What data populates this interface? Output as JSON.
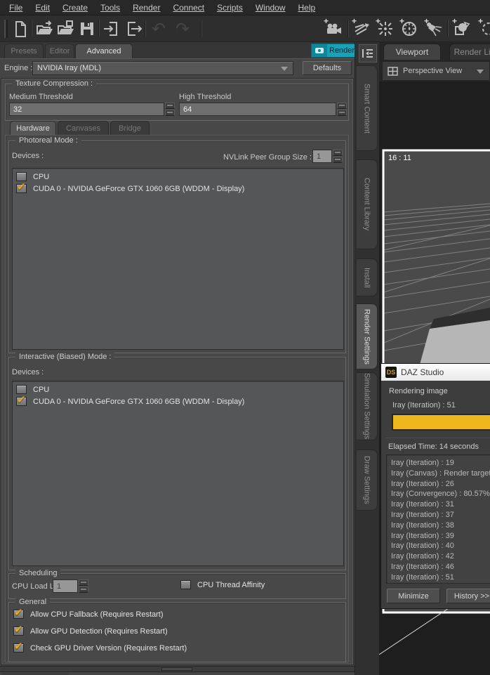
{
  "menu": {
    "items": [
      "File",
      "Edit",
      "Create",
      "Tools",
      "Render",
      "Connect",
      "Scripts",
      "Window",
      "Help"
    ]
  },
  "toolbar": {
    "file_icons": [
      "new-file",
      "open-file",
      "merge-file",
      "save-file",
      "import-file",
      "export-file"
    ],
    "history_icons": [
      "undo",
      "redo"
    ],
    "create_icons": [
      "new-camera",
      "new-distant-light",
      "new-point-light",
      "new-linear-point-light",
      "new-spotlight",
      "new-primitive",
      "new-null"
    ]
  },
  "render_pane": {
    "tabs": [
      {
        "label": "Presets",
        "active": false
      },
      {
        "label": "Editor",
        "active": false
      },
      {
        "label": "Advanced",
        "active": true
      }
    ],
    "render_button": "Render",
    "engine_label": "Engine :",
    "engine_value": "NVIDIA Iray (MDL)",
    "defaults_button": "Defaults",
    "texture_compression": {
      "title": "Texture Compression :",
      "medium_label": "Medium Threshold",
      "medium_value": "32",
      "high_label": "High Threshold",
      "high_value": "64"
    },
    "subtabs": [
      {
        "label": "Hardware",
        "active": true
      },
      {
        "label": "Canvases",
        "active": false
      },
      {
        "label": "Bridge",
        "active": false
      }
    ],
    "photoreal": {
      "title": "Photoreal Mode :",
      "devices_label": "Devices :",
      "nvlink_label": "NVLink Peer Group Size :",
      "nvlink_value": "1",
      "devices": [
        {
          "label": "CPU",
          "checked": false
        },
        {
          "label": "CUDA 0 - NVIDIA GeForce GTX 1060 6GB (WDDM - Display)",
          "checked": true
        }
      ]
    },
    "interactive": {
      "title": "Interactive (Biased) Mode :",
      "devices_label": "Devices :",
      "devices": [
        {
          "label": "CPU",
          "checked": false
        },
        {
          "label": "CUDA 0 - NVIDIA GeForce GTX 1060 6GB (WDDM - Display)",
          "checked": true
        }
      ]
    },
    "scheduling": {
      "title": "Scheduling",
      "cpu_load_label": "CPU Load Limit",
      "cpu_load_value": "1",
      "thread_affinity": {
        "label": "CPU Thread Affinity",
        "checked": false
      }
    },
    "general": {
      "title": "General",
      "options": [
        {
          "label": "Allow CPU Fallback (Requires Restart)",
          "checked": true
        },
        {
          "label": "Allow GPU Detection (Requires Restart)",
          "checked": true
        },
        {
          "label": "Check GPU Driver Version (Requires Restart)",
          "checked": true
        }
      ]
    }
  },
  "dock": {
    "tabs": [
      {
        "label": "Smart Content",
        "active": false
      },
      {
        "label": "Content Library",
        "active": false
      },
      {
        "label": "Install",
        "active": false
      },
      {
        "label": "Render Settings",
        "active": true
      },
      {
        "label": "Simulation Settings",
        "active": false
      },
      {
        "label": "Draw Settings",
        "active": false
      }
    ]
  },
  "viewport_pane": {
    "tabs": [
      {
        "label": "Viewport",
        "active": true
      },
      {
        "label": "Render Lib",
        "active": false
      }
    ],
    "view_selector": "Perspective View",
    "aspect_ratio_label": "16 : 11"
  },
  "render_dialog": {
    "title": "DAZ Studio",
    "logo_text": "DS",
    "status_text": "Rendering image",
    "progress_label": "Iray (Iteration) : 51",
    "elapsed_text": "Elapsed Time:  14 seconds",
    "log_entries": [
      "Iray (Iteration) : 19",
      "Iray (Canvas) : Render target",
      "Iray (Iteration) : 26",
      "Iray (Convergence) : 80.57%",
      "Iray (Iteration) : 31",
      "Iray (Iteration) : 37",
      "Iray (Iteration) : 38",
      "Iray (Iteration) : 39",
      "Iray (Iteration) : 40",
      "Iray (Iteration) : 42",
      "Iray (Iteration) : 46",
      "Iray (Iteration) : 51"
    ],
    "minimize_button": "Minimize",
    "history_button": "History >>"
  },
  "colors": {
    "accent_teal": "#18a2b8",
    "check_amber": "#e9a81b",
    "progress_amber": "#eeb71e"
  }
}
